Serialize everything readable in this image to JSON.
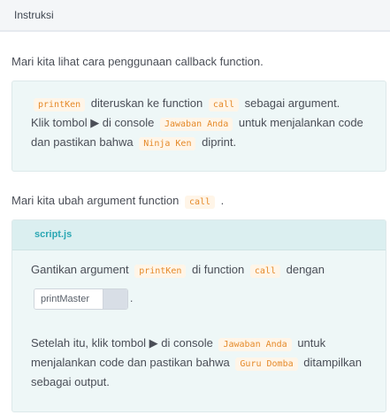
{
  "header": {
    "title": "Instruksi"
  },
  "intro": {
    "text": "Mari kita lihat cara penggunaan callback function."
  },
  "box1": {
    "l1_code1": "printKen",
    "l1_t1": "diteruskan ke function",
    "l1_code2": "call",
    "l1_t2": "sebagai argument.",
    "l2_t1": "Klik tombol ▶ di console",
    "l2_code1": "Jawaban Anda",
    "l2_t2": "untuk menjalankan code",
    "l3_t1": "dan pastikan bahwa",
    "l3_code1": "Ninja Ken",
    "l3_t2": "diprint."
  },
  "second": {
    "t1": "Mari kita ubah argument function",
    "code1": "call",
    "t2": "."
  },
  "box2": {
    "filename": "script.js",
    "a_t1": "Gantikan argument",
    "a_code1": "printKen",
    "a_t2": "di function",
    "a_code2": "call",
    "a_t3": "dengan",
    "input_value": "printMaster",
    "dot": ".",
    "b_t1": "Setelah itu, klik tombol ▶ di console",
    "b_code1": "Jawaban Anda",
    "b_t2": "untuk",
    "c_t1": "menjalankan code dan pastikan bahwa",
    "c_code1": "Guru Domba",
    "c_t2": "ditampilkan",
    "d_t1": "sebagai output."
  }
}
